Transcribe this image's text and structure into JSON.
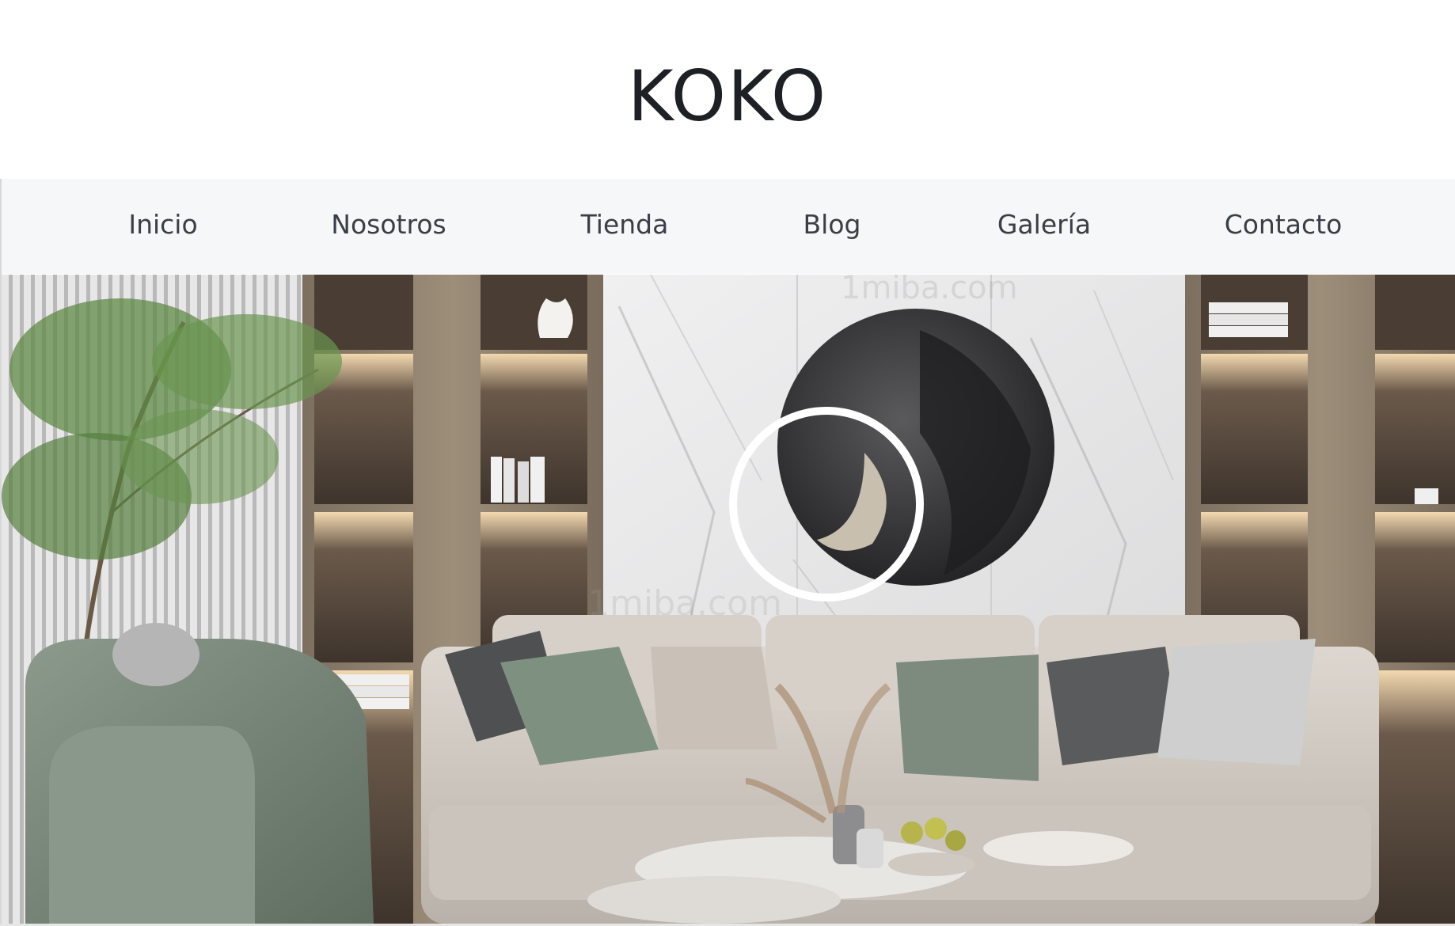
{
  "header": {
    "logo_text": "KOKO"
  },
  "nav": {
    "items": [
      {
        "label": "Inicio"
      },
      {
        "label": "Nosotros"
      },
      {
        "label": "Tienda"
      },
      {
        "label": "Blog"
      },
      {
        "label": "Galería"
      },
      {
        "label": "Contacto"
      }
    ]
  },
  "hero": {
    "image_subject": "living-room-interior",
    "watermark_text": "1miba.com"
  },
  "colors": {
    "logo": "#1d2126",
    "nav_background": "#f6f7f9",
    "nav_text": "#3a3f45",
    "marble": "#e9e9ea",
    "wood": "#8e7f6c",
    "sofa": "#d2ccc5",
    "armchair": "#788779"
  }
}
